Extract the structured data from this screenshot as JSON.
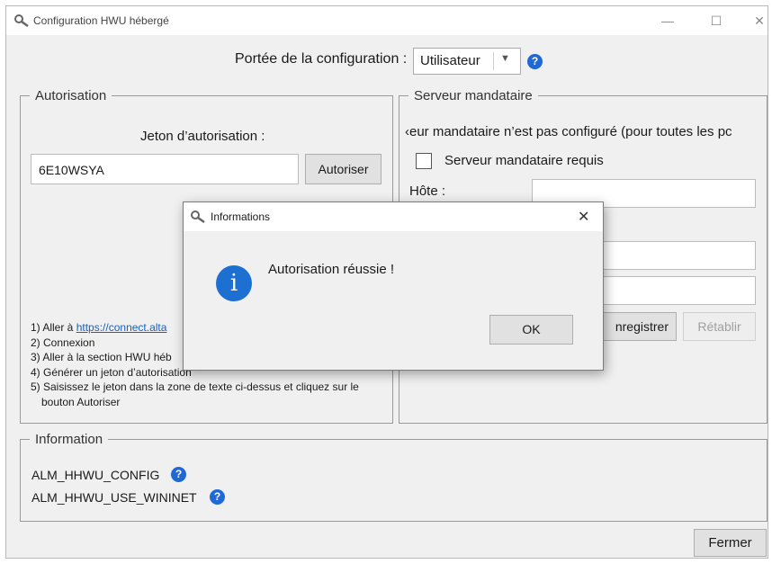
{
  "window": {
    "title": "Configuration HWU hébergé",
    "icon": "magnifier-key-icon"
  },
  "scope": {
    "label": "Portée de la configuration :",
    "selected": "Utilisateur"
  },
  "authorization": {
    "group_title": "Autorisation",
    "token_label": "Jeton d’autorisation :",
    "token_value": "6E10WSYA",
    "authorize_button": "Autoriser",
    "steps": {
      "s1_prefix": "1) Aller à",
      "s1_link": "https://connect.alta",
      "s2": "2) Connexion",
      "s3": "3) Aller à la section HWU héb",
      "s4": "4) Générer un jeton d’autorisation",
      "s5_line1": "5) Saisissez le jeton dans la zone de texte ci-dessus et cliquez sur le",
      "s5_line2": "bouton Autoriser"
    }
  },
  "proxy": {
    "group_title": "Serveur mandataire",
    "status_text": "‹eur mandataire n’est pas configuré (pour toutes les pc",
    "required_label": "Serveur mandataire requis",
    "host_label": "Hôte :",
    "save_button": "nregistrer",
    "reset_button": "Rétablir"
  },
  "information": {
    "group_title": "Information",
    "items": [
      "ALM_HHWU_CONFIG",
      "ALM_HHWU_USE_WININET"
    ]
  },
  "close_button": "Fermer",
  "dialog": {
    "title": "Informations",
    "message": "Autorisation réussie !",
    "ok_button": "OK",
    "icon": "info-icon"
  },
  "colors": {
    "accent": "#1f68d6",
    "window_bg": "#f0f0f0",
    "link": "#1f5fb5"
  }
}
